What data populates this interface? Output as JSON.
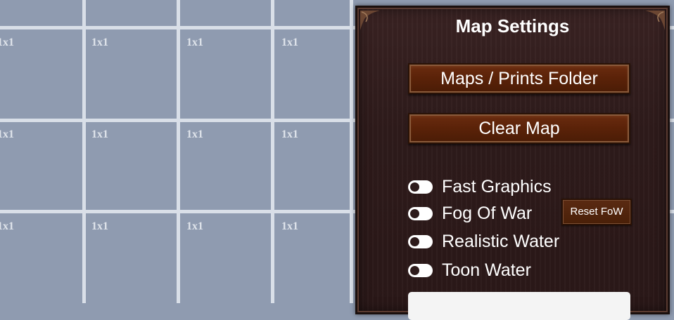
{
  "grid": {
    "cell_label": "1x1"
  },
  "settings_panel": {
    "title": "Map Settings",
    "maps_folder_button": "Maps / Prints Folder",
    "clear_map_button": "Clear Map",
    "toggles": [
      {
        "label": "Fast Graphics",
        "state": "off"
      },
      {
        "label": "Fog Of War",
        "state": "off"
      },
      {
        "label": "Realistic Water",
        "state": "off"
      },
      {
        "label": "Toon Water",
        "state": "off"
      }
    ],
    "reset_fow_button": "Reset FoW",
    "bottom_field_value": ""
  },
  "colors": {
    "grid_background": "#8f9bb0",
    "grid_lines": "#d9dfe8",
    "panel_wood": "#2e1b1b",
    "button_wood": "#5a2208",
    "text": "#ffffff"
  }
}
